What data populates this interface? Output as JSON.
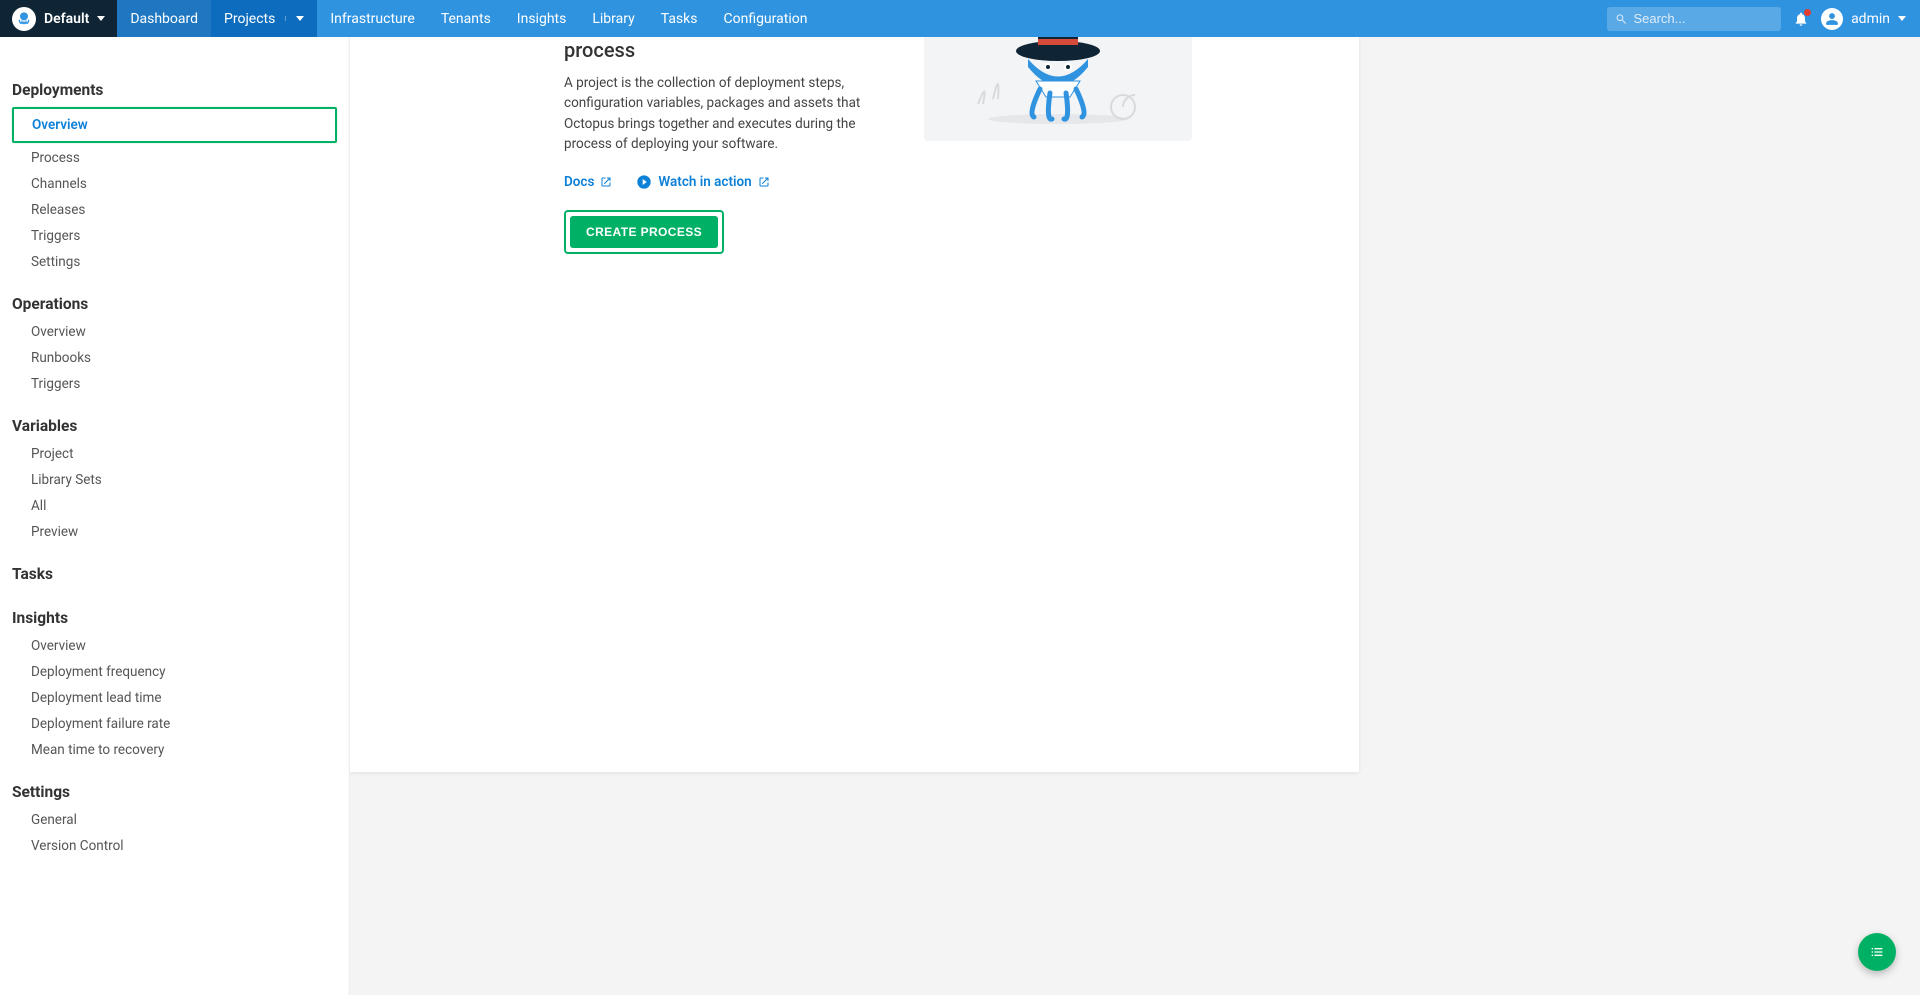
{
  "colors": {
    "accent_blue": "#2f93e0",
    "accent_green": "#00b065",
    "link_blue": "#0d80d8"
  },
  "topnav": {
    "space_name": "Default",
    "items": [
      {
        "label": "Dashboard"
      },
      {
        "label": "Projects"
      },
      {
        "label": "Infrastructure"
      },
      {
        "label": "Tenants"
      },
      {
        "label": "Insights"
      },
      {
        "label": "Library"
      },
      {
        "label": "Tasks"
      },
      {
        "label": "Configuration"
      }
    ],
    "search_placeholder": "Search...",
    "user_name": "admin"
  },
  "sidebar": {
    "sections": [
      {
        "title": "Deployments",
        "items": [
          "Overview",
          "Process",
          "Channels",
          "Releases",
          "Triggers",
          "Settings"
        ],
        "active_item": "Overview"
      },
      {
        "title": "Operations",
        "items": [
          "Overview",
          "Runbooks",
          "Triggers"
        ]
      },
      {
        "title": "Variables",
        "items": [
          "Project",
          "Library Sets",
          "All",
          "Preview"
        ]
      },
      {
        "title": "Tasks",
        "items": []
      },
      {
        "title": "Insights",
        "items": [
          "Overview",
          "Deployment frequency",
          "Deployment lead time",
          "Deployment failure rate",
          "Mean time to recovery"
        ]
      },
      {
        "title": "Settings",
        "items": [
          "General",
          "Version Control"
        ]
      }
    ]
  },
  "main": {
    "empty_title": "process",
    "empty_desc": "A project is the collection of deployment steps, configuration variables, packages and assets that Octopus brings together and executes during the process of deploying your software.",
    "docs_label": "Docs",
    "watch_label": "Watch in action",
    "create_label": "CREATE PROCESS"
  }
}
